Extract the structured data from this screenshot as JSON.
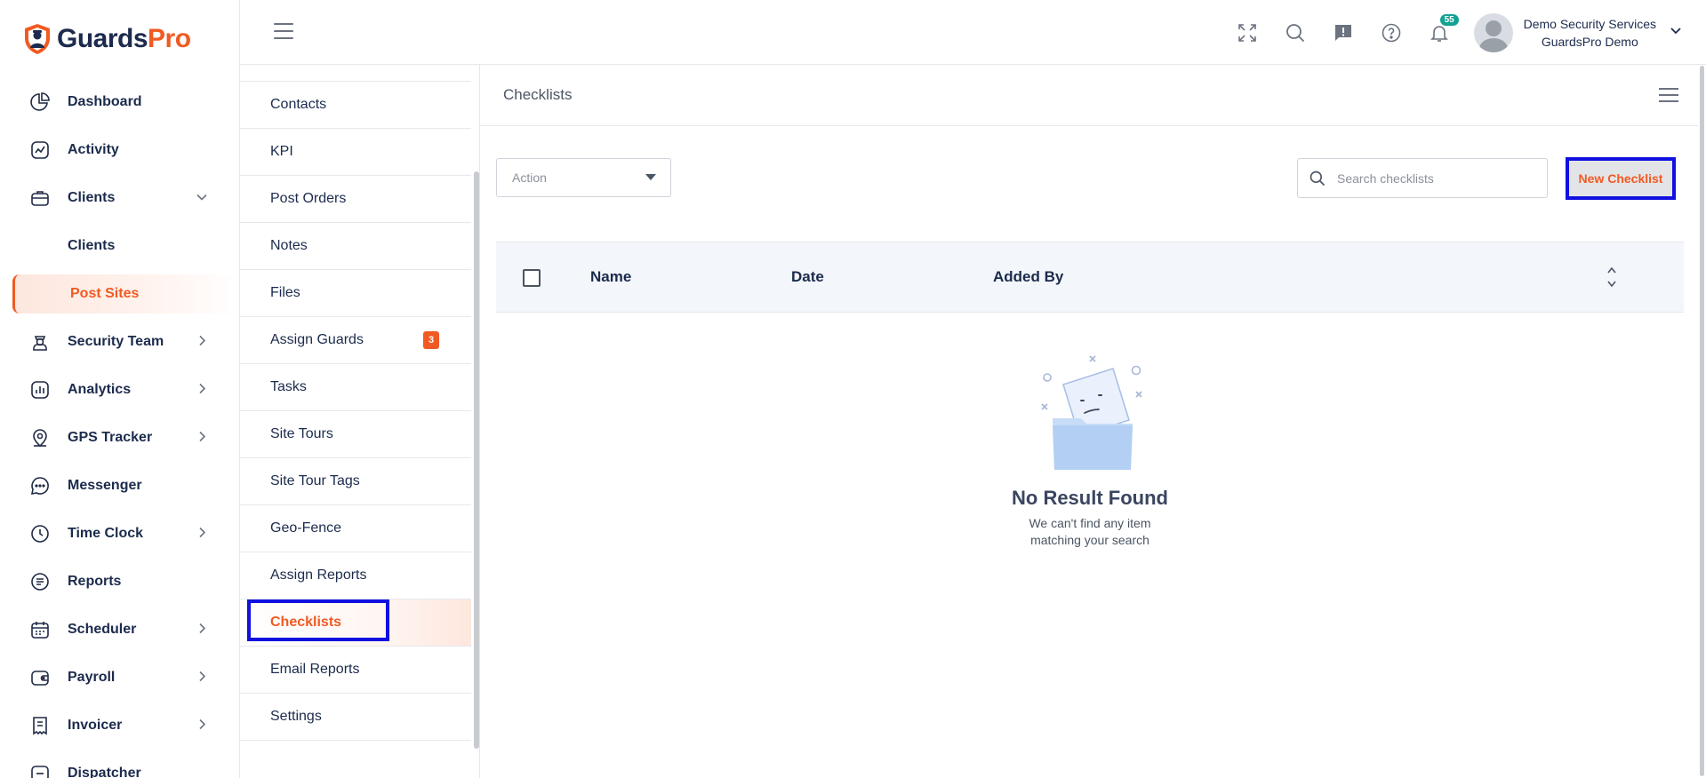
{
  "brand": {
    "name_part1": "Guards",
    "name_part2": "Pro",
    "accent": "#f15a22",
    "navy": "#1c2b4d"
  },
  "sidebar": {
    "items": [
      {
        "label": "Dashboard",
        "icon": "pie-chart-icon"
      },
      {
        "label": "Activity",
        "icon": "activity-chart-icon"
      },
      {
        "label": "Clients",
        "icon": "briefcase-icon",
        "expanded": true
      },
      {
        "label": "Security Team",
        "icon": "guard-icon"
      },
      {
        "label": "Analytics",
        "icon": "bar-chart-icon"
      },
      {
        "label": "GPS Tracker",
        "icon": "map-pin-icon"
      },
      {
        "label": "Messenger",
        "icon": "chat-bubble-icon"
      },
      {
        "label": "Time Clock",
        "icon": "clock-icon"
      },
      {
        "label": "Reports",
        "icon": "document-icon"
      },
      {
        "label": "Scheduler",
        "icon": "calendar-icon"
      },
      {
        "label": "Payroll",
        "icon": "wallet-icon"
      },
      {
        "label": "Invoicer",
        "icon": "receipt-icon"
      },
      {
        "label": "Dispatcher",
        "icon": "dispatch-icon"
      }
    ],
    "clients_sub": [
      {
        "label": "Clients"
      },
      {
        "label": "Post Sites",
        "active": true
      }
    ]
  },
  "topbar": {
    "notification_count": "55",
    "user_name": "Demo Security Services",
    "user_org": "GuardsPro Demo"
  },
  "submenu": {
    "items": [
      {
        "label": "Contacts"
      },
      {
        "label": "KPI"
      },
      {
        "label": "Post Orders"
      },
      {
        "label": "Notes"
      },
      {
        "label": "Files"
      },
      {
        "label": "Assign Guards",
        "badge": "3"
      },
      {
        "label": "Tasks"
      },
      {
        "label": "Site Tours"
      },
      {
        "label": "Site Tour Tags"
      },
      {
        "label": "Geo-Fence"
      },
      {
        "label": "Assign Reports"
      },
      {
        "label": "Checklists",
        "active": true
      },
      {
        "label": "Email Reports"
      },
      {
        "label": "Settings"
      }
    ]
  },
  "main": {
    "title": "Checklists",
    "action_label": "Action",
    "search_placeholder": "Search checklists",
    "new_button": "New Checklist",
    "columns": [
      "Name",
      "Date",
      "Added By"
    ],
    "empty_title": "No Result Found",
    "empty_line1": "We can't find any item",
    "empty_line2": "matching your search"
  }
}
